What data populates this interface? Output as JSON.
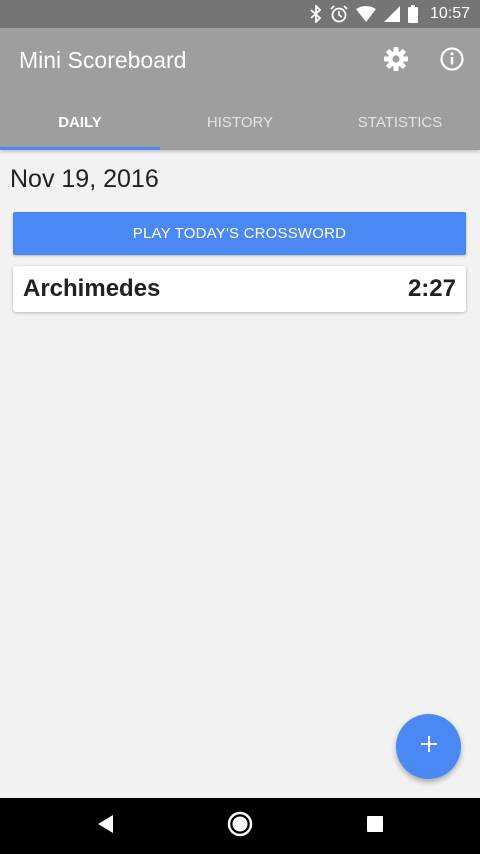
{
  "status_bar": {
    "time": "10:57",
    "icons": [
      "bluetooth-icon",
      "alarm-icon",
      "wifi-icon",
      "cell-signal-icon",
      "battery-icon"
    ]
  },
  "app_bar": {
    "title": "Mini Scoreboard",
    "actions": [
      "gear-icon",
      "info-icon"
    ]
  },
  "tabs": [
    {
      "label": "DAILY",
      "active": true
    },
    {
      "label": "HISTORY",
      "active": false
    },
    {
      "label": "STATISTICS",
      "active": false
    }
  ],
  "main": {
    "date": "Nov 19, 2016",
    "play_button_label": "PLAY TODAY'S CROSSWORD",
    "scores": [
      {
        "name": "Archimedes",
        "time": "2:27"
      }
    ]
  },
  "fab": {
    "icon": "plus-icon"
  },
  "nav_bar": {
    "icons": [
      "back-icon",
      "home-icon",
      "recents-icon"
    ]
  },
  "colors": {
    "accent": "#4a89f3",
    "app_bar": "#9e9e9e",
    "status_bar": "#757575",
    "background": "#f2f2f2"
  }
}
